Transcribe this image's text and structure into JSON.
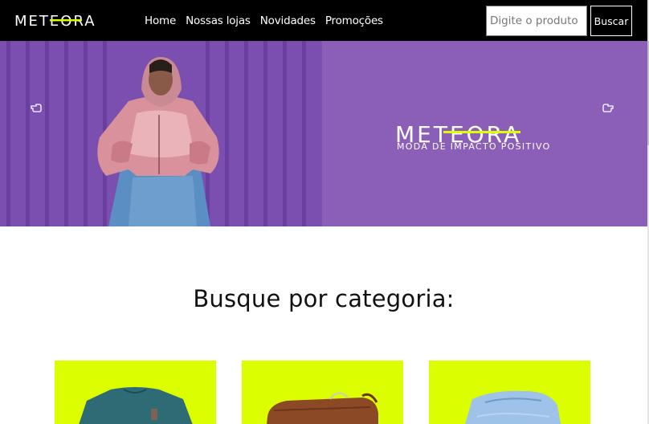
{
  "navbar": {
    "logo_text": "METEORA",
    "links": [
      {
        "label": "Home"
      },
      {
        "label": "Nossas lojas"
      },
      {
        "label": "Novidades"
      },
      {
        "label": "Promoções"
      }
    ],
    "search": {
      "placeholder": "Digite o produto",
      "value": "",
      "button_label": "Buscar"
    }
  },
  "hero": {
    "brand_text": "METEORA",
    "tagline": "MODA DE IMPACTO POSITIVO",
    "prev_icon": "hand-pointing-left-icon",
    "next_icon": "hand-pointing-right-icon"
  },
  "categories": {
    "title": "Busque por categoria:",
    "items": [
      {
        "icon": "t-shirt-photo"
      },
      {
        "icon": "handbag-photo"
      },
      {
        "icon": "jeans-photo"
      }
    ]
  },
  "colors": {
    "navbar_bg": "#000000",
    "hero_bg": "#8b5fb8",
    "accent": "#dbff00",
    "text": "#111111"
  }
}
